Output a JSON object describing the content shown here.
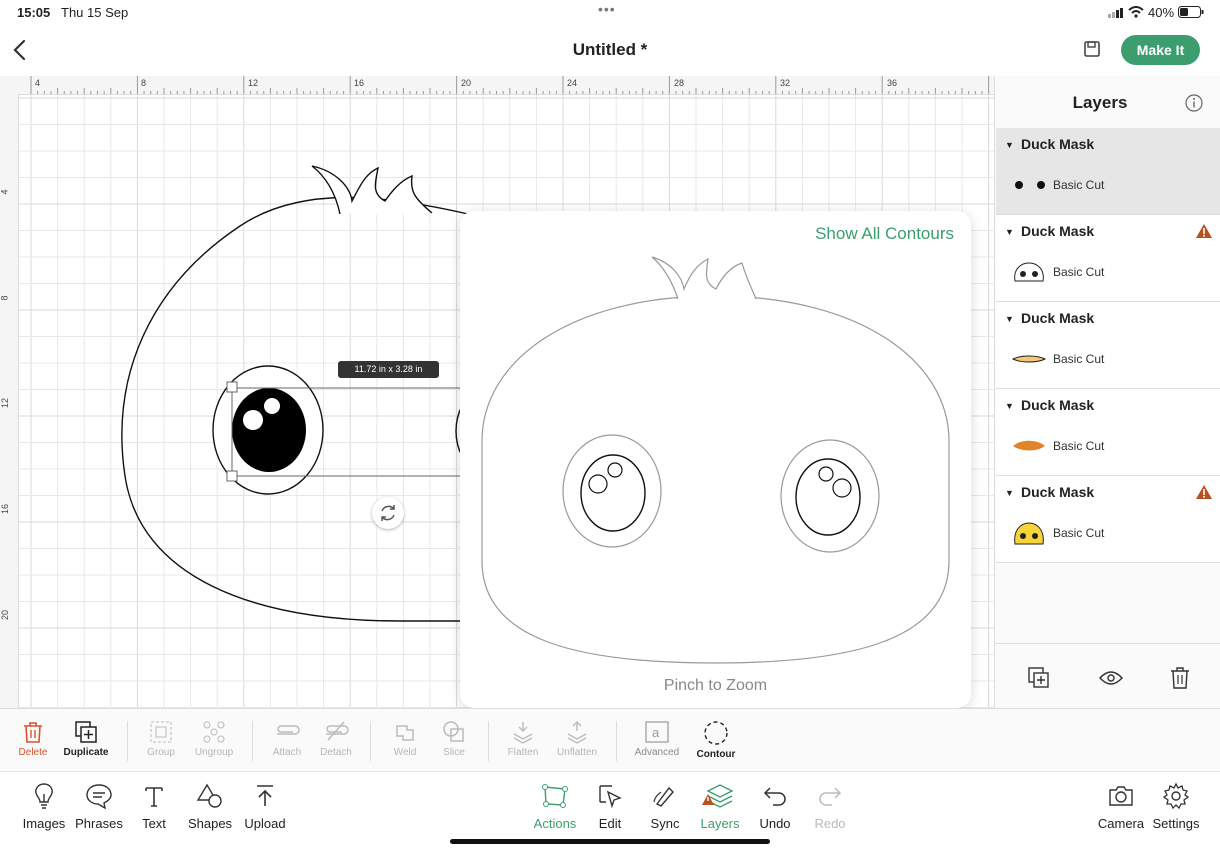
{
  "status_bar": {
    "time": "15:05",
    "date": "Thu 15 Sep",
    "battery": "40%"
  },
  "header": {
    "title": "Untitled *",
    "make_it": "Make It"
  },
  "canvas": {
    "ruler_top": [
      "4",
      "8",
      "12",
      "16",
      "20",
      "24",
      "28",
      "32",
      "36"
    ],
    "ruler_left": [
      "4",
      "8",
      "12",
      "16",
      "20"
    ],
    "dimensions_badge": "11.72 in x 3.28 in"
  },
  "contour_popover": {
    "show_all": "Show All Contours",
    "hint": "Pinch to Zoom"
  },
  "layers": {
    "title": "Layers",
    "groups": [
      {
        "name": "Duck Mask",
        "operation": "Basic Cut",
        "thumb": "eyes",
        "warning": false,
        "selected": true
      },
      {
        "name": "Duck Mask",
        "operation": "Basic Cut",
        "thumb": "face-outline",
        "warning": true,
        "selected": false
      },
      {
        "name": "Duck Mask",
        "operation": "Basic Cut",
        "thumb": "beak-outline",
        "warning": false,
        "selected": false
      },
      {
        "name": "Duck Mask",
        "operation": "Basic Cut",
        "thumb": "beak-orange",
        "warning": false,
        "selected": false
      },
      {
        "name": "Duck Mask",
        "operation": "Basic Cut",
        "thumb": "face-yellow",
        "warning": true,
        "selected": false
      }
    ]
  },
  "action_toolbar": {
    "delete": "Delete",
    "duplicate": "Duplicate",
    "group": "Group",
    "ungroup": "Ungroup",
    "attach": "Attach",
    "detach": "Detach",
    "weld": "Weld",
    "slice": "Slice",
    "flatten": "Flatten",
    "unflatten": "Unflatten",
    "advanced": "Advanced",
    "contour": "Contour"
  },
  "bottom_toolbar": {
    "images": "Images",
    "phrases": "Phrases",
    "text": "Text",
    "shapes": "Shapes",
    "upload": "Upload",
    "actions": "Actions",
    "edit": "Edit",
    "sync": "Sync",
    "layers": "Layers",
    "undo": "Undo",
    "redo": "Redo",
    "camera": "Camera",
    "settings": "Settings"
  },
  "colors": {
    "accent": "#3c9e6e",
    "warning": "#b8501f",
    "delete": "#d9532c"
  }
}
